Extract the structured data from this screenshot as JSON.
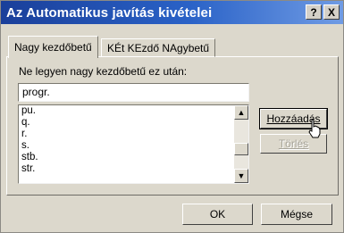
{
  "dialog": {
    "title": "Az Automatikus javítás kivételei",
    "help_button": "?",
    "close_button": "X"
  },
  "tabs": [
    {
      "label": "Nagy kezdőbetű",
      "active": true
    },
    {
      "label": "KÉt KEzdő NAgybetű",
      "active": false
    }
  ],
  "field": {
    "label": "Ne legyen nagy kezdőbetű ez után:",
    "value": "progr."
  },
  "list": {
    "items": [
      "pu.",
      "q.",
      "r.",
      "s.",
      "stb.",
      "str."
    ]
  },
  "buttons": {
    "add": "Hozzáadás",
    "delete": "Törlés",
    "ok": "OK",
    "cancel": "Mégse"
  },
  "scrollbar_up": "▲",
  "scrollbar_down": "▼"
}
